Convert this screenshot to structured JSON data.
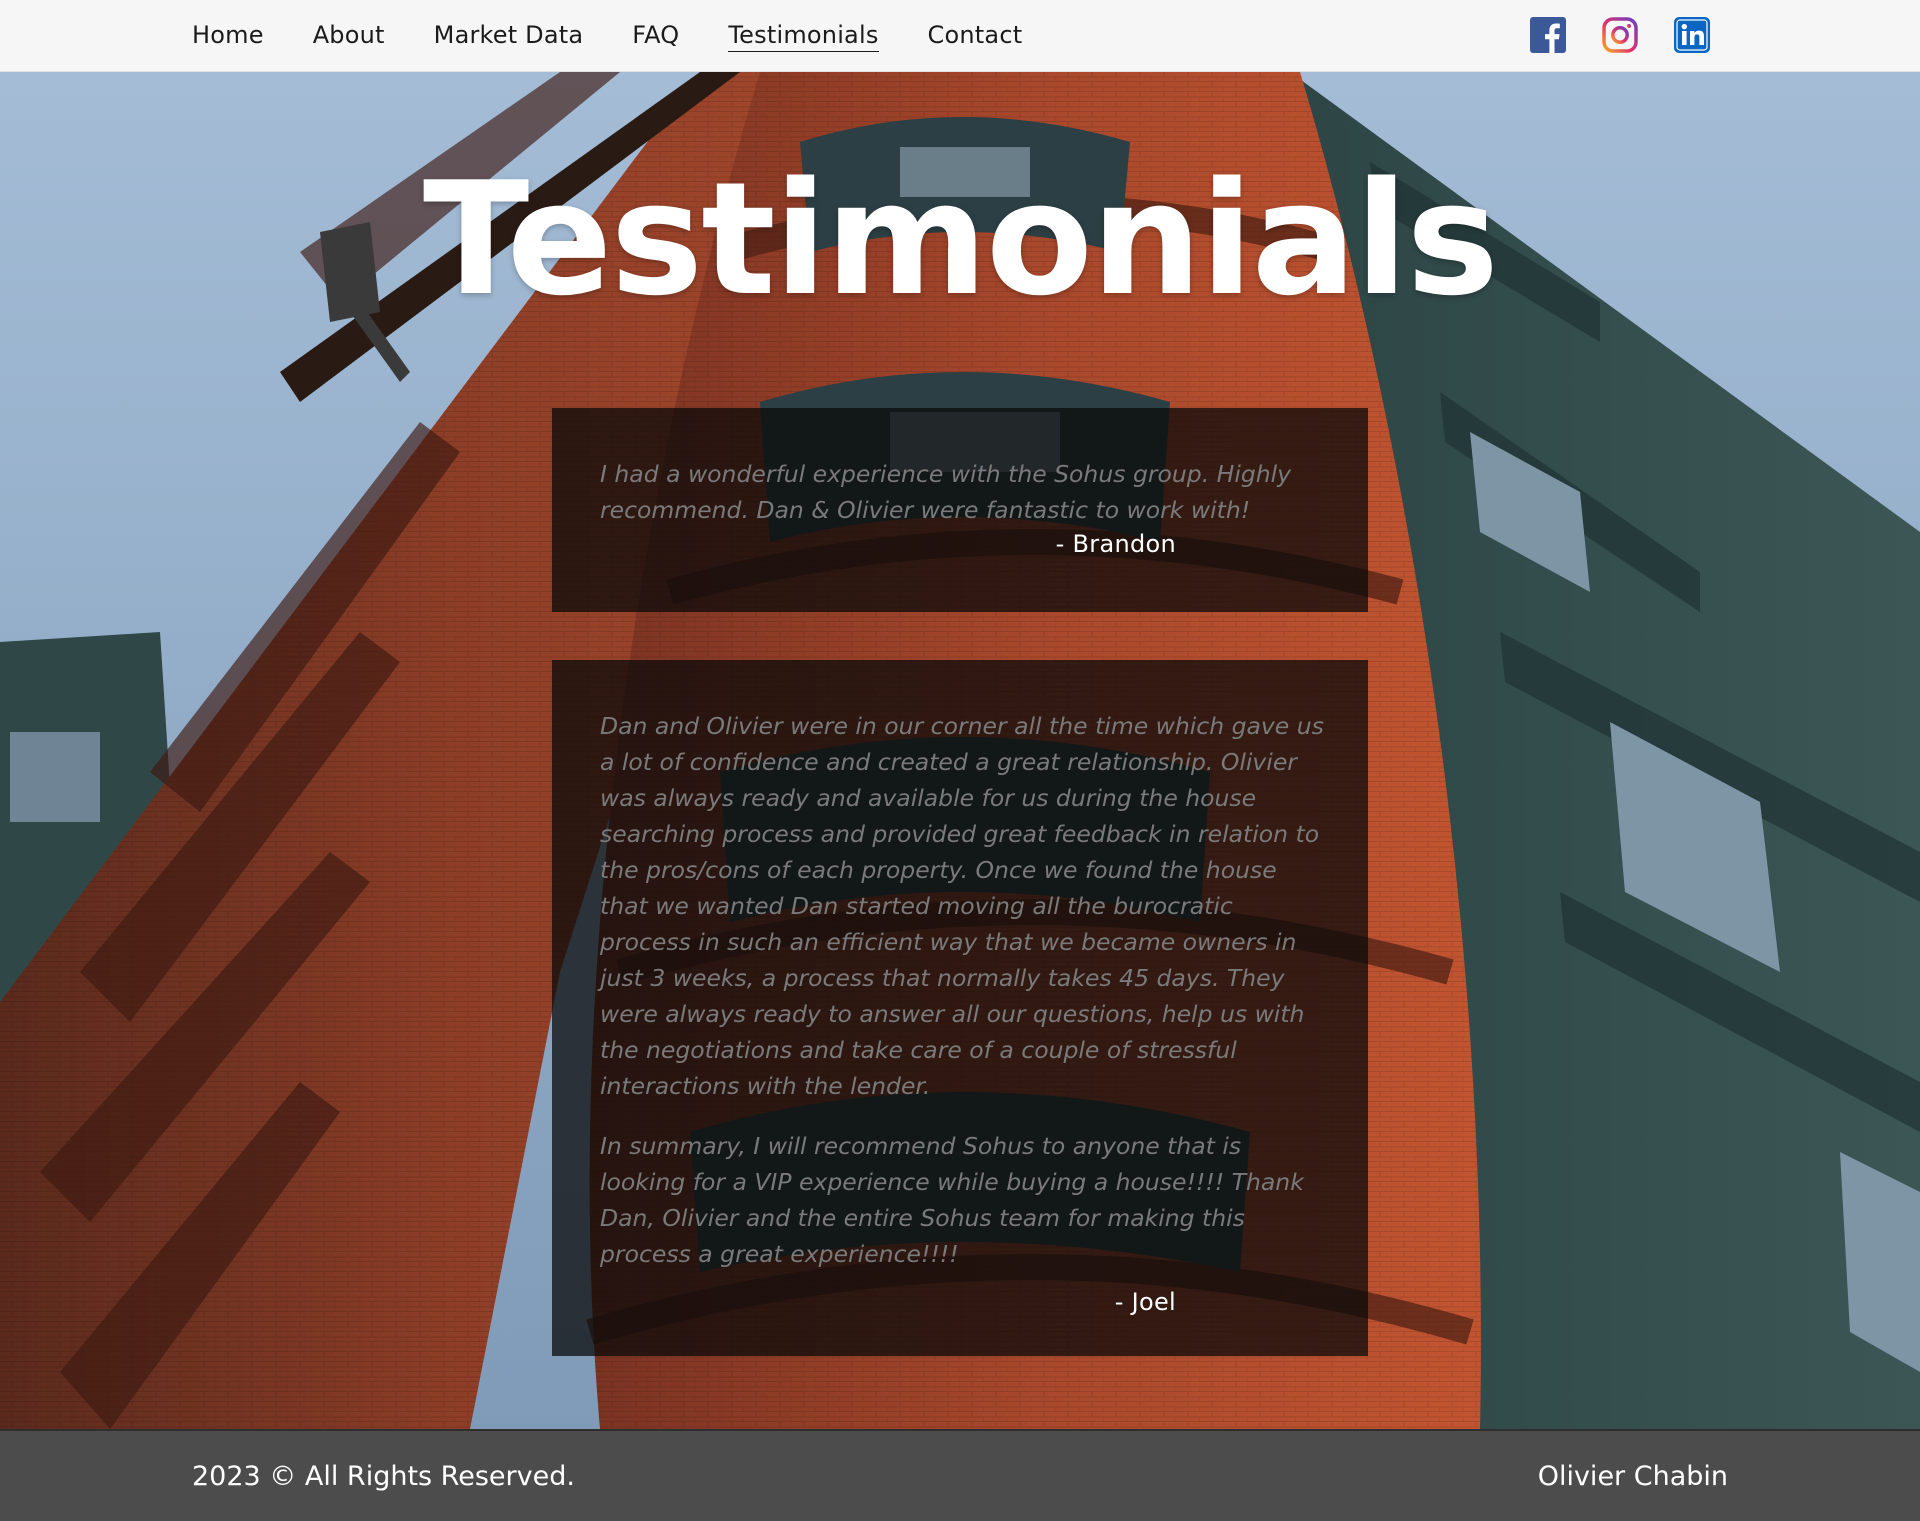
{
  "nav": {
    "items": [
      {
        "label": "Home"
      },
      {
        "label": "About"
      },
      {
        "label": "Market Data"
      },
      {
        "label": "FAQ"
      },
      {
        "label": "Testimonials",
        "active": true
      },
      {
        "label": "Contact"
      }
    ],
    "socials": [
      {
        "icon": "facebook-icon",
        "color": "#3b5998"
      },
      {
        "icon": "instagram-icon",
        "color": "#c13584"
      },
      {
        "icon": "linkedin-icon",
        "color": "#0a66c2"
      }
    ]
  },
  "page": {
    "title": "Testimonials"
  },
  "testimonials": [
    {
      "paragraphs": [
        "I had a wonderful experience with the Sohus group. Highly recommend. Dan & Olivier were fantastic to work with!"
      ],
      "author": "- Brandon"
    },
    {
      "paragraphs": [
        "Dan and Olivier were in our corner all the time which gave us a lot of confidence and created a great relationship. Olivier was always ready and available for us during the house searching process and provided great feedback in relation to the pros/cons of each property. Once we found the house that we wanted Dan started moving all the burocratic process in such an efficient way that we became owners in just 3 weeks, a process that normally takes 45 days. They were always ready to answer all our questions, help us with the negotiations and take care of a couple of stressful interactions with the lender.",
        "In summary, I will recommend Sohus to anyone that is looking for a VIP experience while buying a house!!!! Thank Dan, Olivier and the entire Sohus team for making this process a great experience!!!!"
      ],
      "author": "- Joel"
    }
  ],
  "footer": {
    "copyright": "2023 © All Rights Reserved.",
    "name": "Olivier Chabin"
  }
}
